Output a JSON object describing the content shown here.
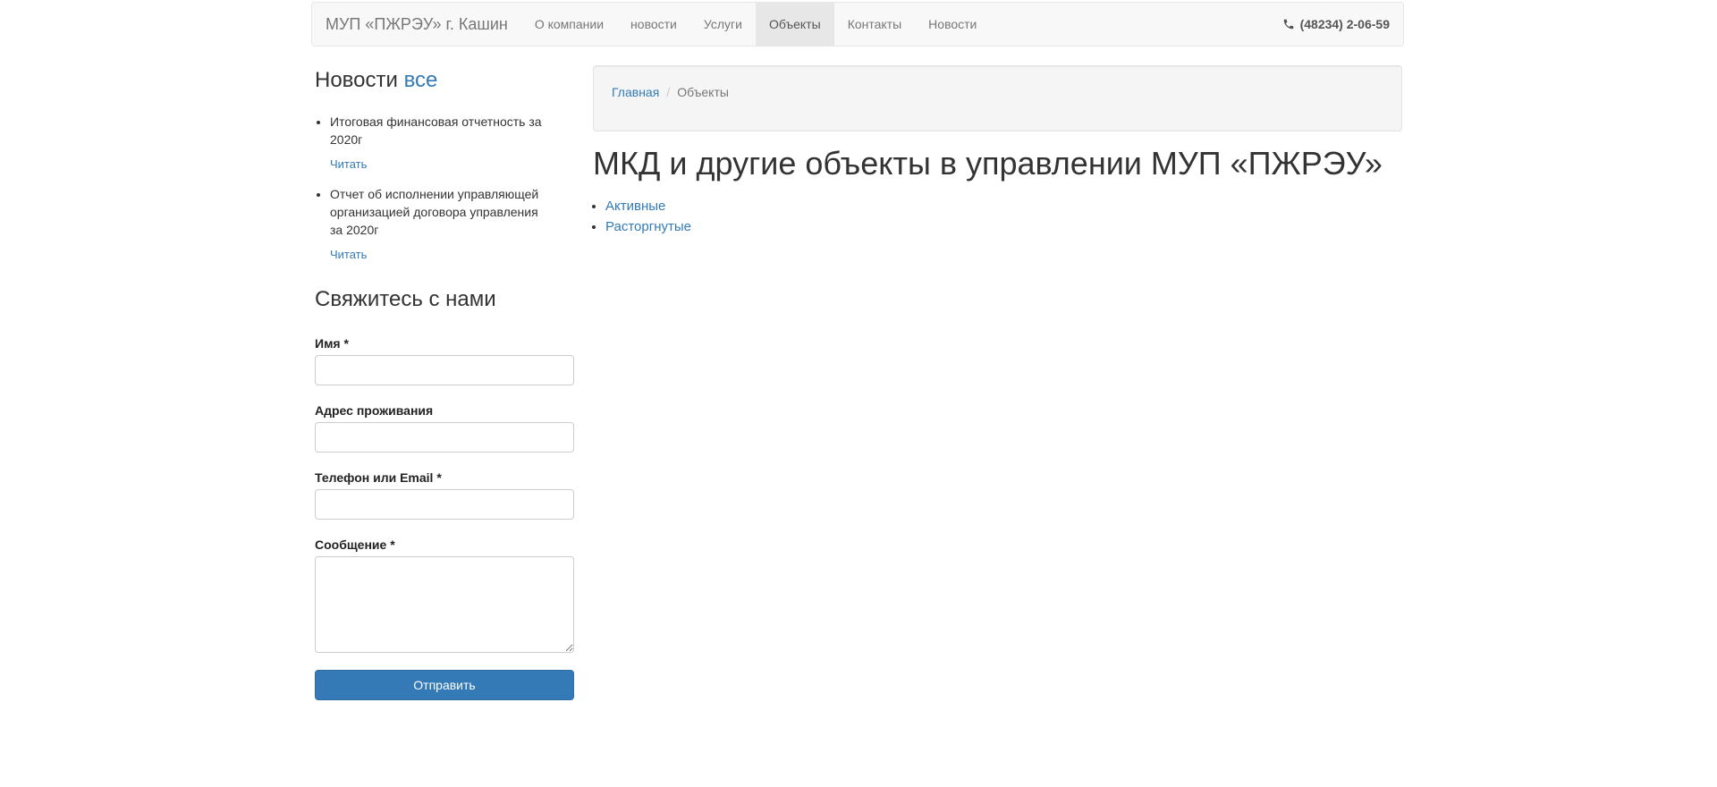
{
  "navbar": {
    "brand": "МУП «ПЖРЭУ» г. Кашин",
    "items": [
      {
        "label": "О компании",
        "active": false
      },
      {
        "label": "новости",
        "active": false
      },
      {
        "label": "Услуги",
        "active": false
      },
      {
        "label": "Объекты",
        "active": true
      },
      {
        "label": "Контакты",
        "active": false
      },
      {
        "label": "Новости",
        "active": false
      }
    ],
    "phone": "(48234) 2-06-59"
  },
  "sidebar": {
    "news": {
      "title": "Новости",
      "all_link": "все",
      "read_label": "Читать",
      "items": [
        {
          "text": "Итоговая финансовая отчетность за 2020г"
        },
        {
          "text": "Отчет об исполнении управляющей организацией договора управления за 2020г"
        }
      ]
    },
    "contact": {
      "title": "Свяжитесь с нами",
      "required_marker": "*",
      "fields": [
        {
          "label": "Имя",
          "required": true,
          "value": "",
          "type": "input"
        },
        {
          "label": "Адрес проживания",
          "required": false,
          "value": "",
          "type": "input"
        },
        {
          "label": "Телефон или Email",
          "required": true,
          "value": "",
          "type": "input"
        },
        {
          "label": "Сообщение",
          "required": true,
          "value": "",
          "type": "textarea"
        }
      ],
      "submit_label": "Отправить"
    }
  },
  "main": {
    "breadcrumb": {
      "home": "Главная",
      "separator": "/",
      "current": "Объекты"
    },
    "title": "МКД и другие объекты в управлении МУП «ПЖРЭУ»",
    "links": [
      {
        "label": "Активные"
      },
      {
        "label": "Расторгнутые"
      }
    ]
  },
  "colors": {
    "link": "#337ab7",
    "button_bg": "#337ab7",
    "button_border": "#2e6da4",
    "navbar_bg": "#f8f8f8",
    "navbar_border": "#e7e7e7",
    "navbar_active_bg": "#e7e7e7",
    "navbar_text": "#777777",
    "well_bg": "#f5f5f5",
    "text": "#333333"
  }
}
